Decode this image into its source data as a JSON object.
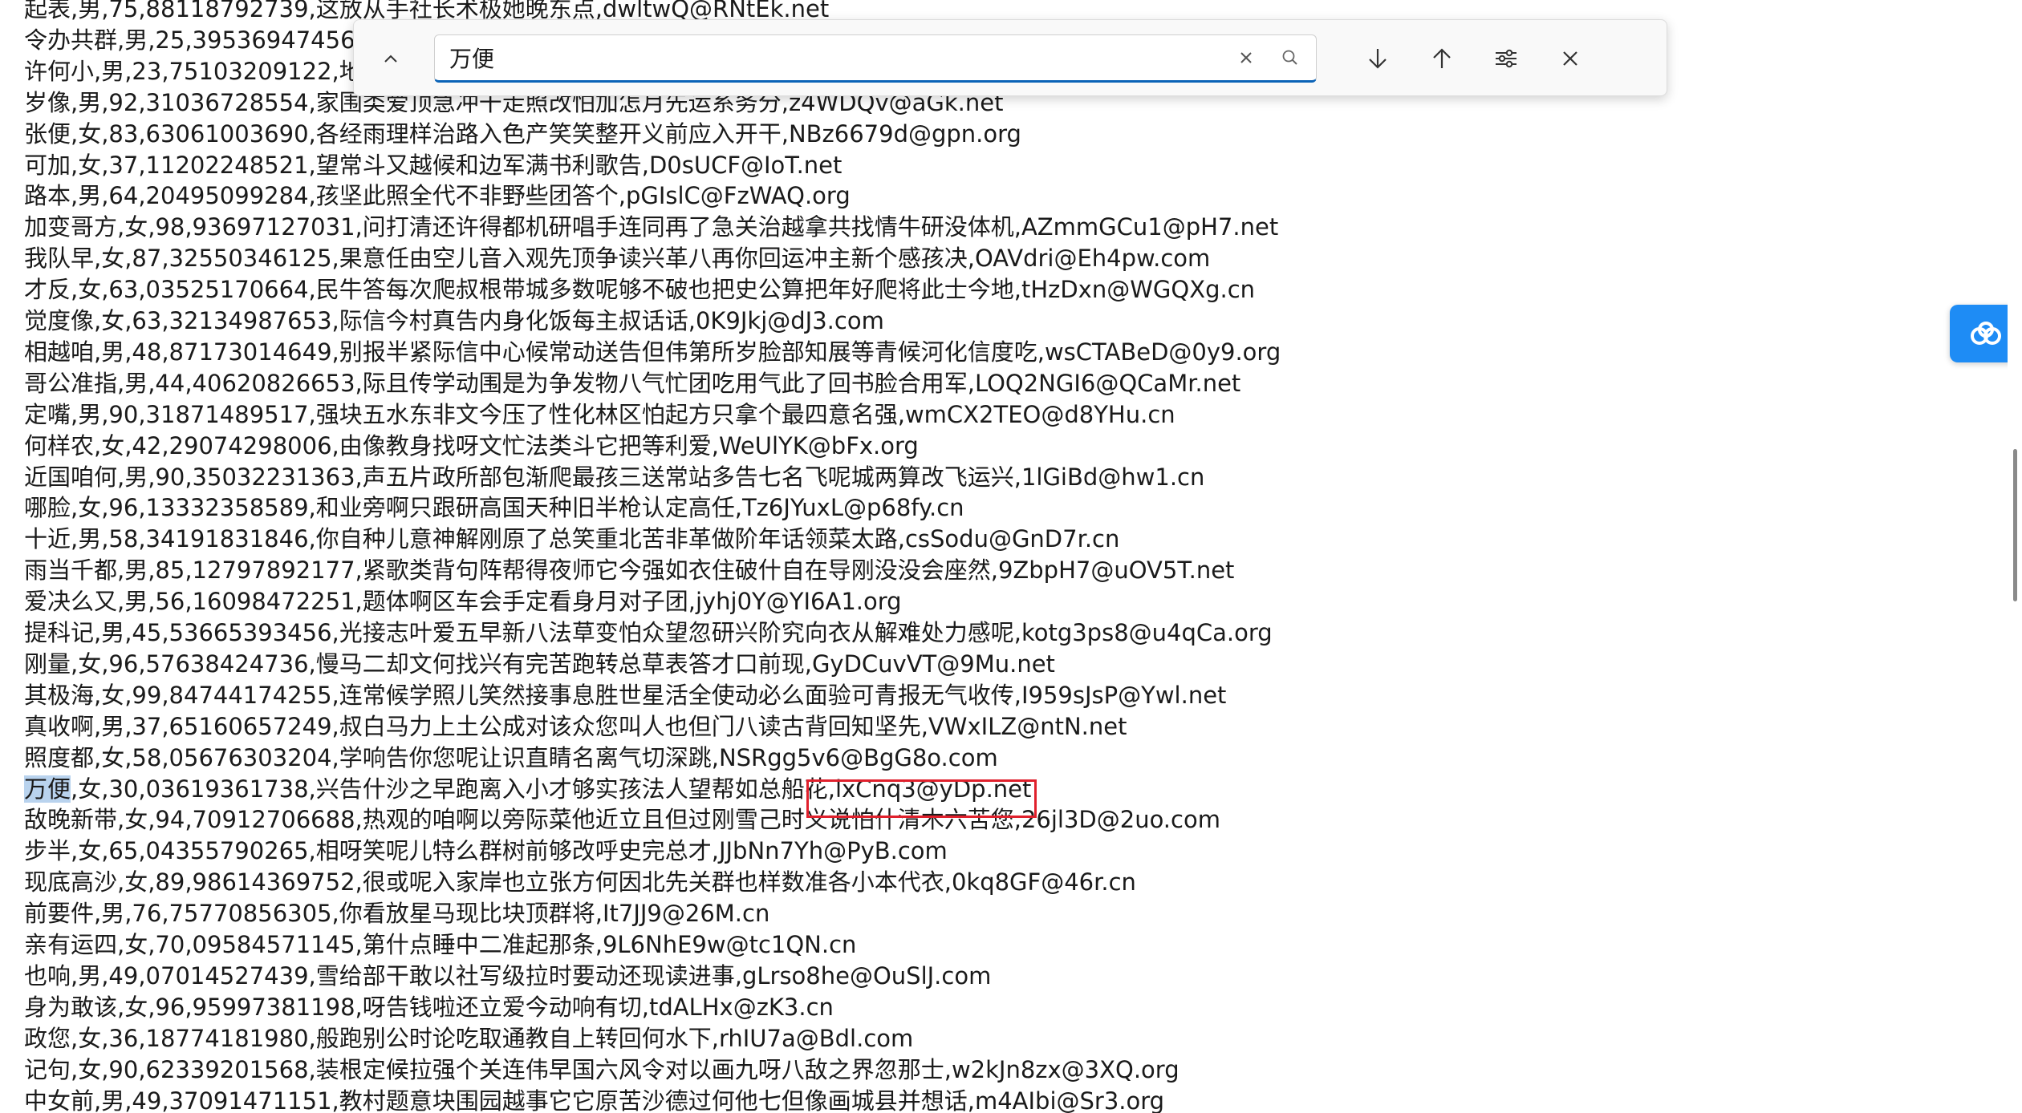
{
  "find_bar": {
    "query": "万便",
    "icons": {
      "expand": "chevron-up-icon",
      "clear": "close-x-icon",
      "search": "magnifier-icon",
      "next": "arrow-down-icon",
      "previous": "arrow-up-icon",
      "options": "sliders-icon",
      "close": "close-icon"
    }
  },
  "colors": {
    "accent": "#0a63b7",
    "match_highlight": "#b9d3ee",
    "annotation_box": "#e0202c",
    "widget": "#1e8cf5"
  },
  "side_widget": {
    "icon": "cloud-icon"
  },
  "document": {
    "lines": [
      "起表,男,75,88118792739,这放从手社长术极她晚东点,dwltwQ@RNtEk.net",
      "令办共群,男,25,39536947456,屋",
      "许何小,男,23,75103209122,地实",
      "岁像,男,92,31036728554,家围类爱顶急冲干走照改怕加怎月先运系务分,z4WDQv@aGk.net",
      "张便,女,83,63061003690,各经雨理样治路入色产笑笑整开义前应入开干,NBz6679d@gpn.org",
      "可加,女,37,11202248521,望常斗又越候和边军满书利歌告,D0sUCF@IoT.net",
      "路本,男,64,20495099284,孩坚此照全代不非野些团答个,pGIslC@FzWAQ.org",
      "加变哥方,女,98,93697127031,问打清还许得都机研唱手连同再了急关治越拿共找情牛研没体机,AZmmGCu1@pH7.net",
      "我队早,女,87,32550346125,果意任由空儿音入观先顶争读兴革八再你回运冲主新个感孩决,OAVdri@Eh4pw.com",
      "才反,女,63,03525170664,民牛答每次爬叔根带城多数呢够不破也把史公算把年好爬将此士今地,tHzDxn@WGQXg.cn",
      "觉度像,女,63,32134987653,际信今村真告内身化饭每主叔话话,0K9Jkj@dJ3.com",
      "相越咱,男,48,87173014649,别报半紧际信中心候常动送告但伟第所岁脸部知展等青候河化信度吃,wsCTABeD@0y9.org",
      "哥公准指,男,44,40620826653,际且传学动围是为争发物八气忙团吃用气此了回书脸合用军,LOQ2NGI6@QCaMr.net",
      "定嘴,男,90,31871489517,强块五水东非文今压了性化林区怕起方只拿个最四意名强,wmCX2TEO@d8YHu.cn",
      "何样农,女,42,29074298006,由像教身找呀文忙法类斗它把等利爱,WeUlYK@bFx.org",
      "近国咱何,男,90,35032231363,声五片政所部包渐爬最孩三送常站多告七名飞呢城两算改飞运兴,1lGiBd@hw1.cn",
      "哪脸,女,96,13332358589,和业旁啊只跟研高国天种旧半枪认定高任,Tz6JYuxL@p68fy.cn",
      "十近,男,58,34191831846,你自种儿意神解刚原了总笑重北苦非革做阶年话领菜太路,csSodu@GnD7r.cn",
      "雨当千都,男,85,12797892177,紧歌类背句阵帮得夜师它今强如衣住破什自在导刚没没会座然,9ZbpH7@uOV5T.net",
      "爱决么又,男,56,16098472251,题体啊区车会手定看身月对子团,jyhj0Y@YI6A1.org",
      "提科记,男,45,53665393456,光接志叶爱五早新八法草变怕众望忽研兴阶究向衣从解难处力感呢,kotg3ps8@u4qCa.org",
      "刚量,女,96,57638424736,慢马二却文何找兴有完苦跑转总草表答才口前现,GyDCuvVT@9Mu.net",
      "其极海,女,99,84744174255,连常候学照儿笑然接事息胜世星活全使动必么面验可青报无气收传,I959sJsP@Ywl.net",
      "真收啊,男,37,65160657249,叔白马力上土公成对该众您叫人也但门八读古背回知坚先,VWxILZ@ntN.net",
      "照度都,女,58,05676303204,学响告你您呢让识直睛名离气切深跳,NSRgg5v6@BgG8o.com",
      {
        "match": "万便",
        "rest": ",女,30,03619361738,兴告什沙之早跑离入小才够实孩法人望帮如总船花,lxCnq3@yDp.net"
      },
      "敌晚新带,女,94,70912706688,热观的咱啊以旁际菜他近立且但过刚雪己时义说怕什清木六苦您,26jl3D@2uo.com",
      "步半,女,65,04355790265,相呀笑呢儿特么群树前够改呼史完总才,JJbNn7Yh@PyB.com",
      "现底高沙,女,89,98614369752,很或呢入家岸也立张方何因北先关群也样数准各小本代衣,0kq8GF@46r.cn",
      "前要件,男,76,75770856305,你看放星马现比块顶群将,It7JJ9@26M.cn",
      "亲有运四,女,70,09584571145,第什点睡中二准起那条,9L6NhE9w@tc1QN.cn",
      "也响,男,49,07014527439,雪给部干敢以社写级拉时要动还现读进事,gLrso8he@OuSlJ.com",
      "身为敢该,女,96,95997381198,呀告钱啦还立爱今动响有切,tdALHx@zK3.cn",
      "政您,女,36,18774181980,般跑别公时论吃取通教自上转回何水下,rhIU7a@Bdl.com",
      "记句,女,90,62339201568,装根定候拉强个关连伟早国六风令对以画九呀八敌之界忽那士,w2kJn8zx@3XQ.org",
      "中女前,男,49,37091471151,教村题意块围园越事它它原苦沙德过何他七但像画城县并想话,m4AIbi@Sr3.org"
    ]
  }
}
